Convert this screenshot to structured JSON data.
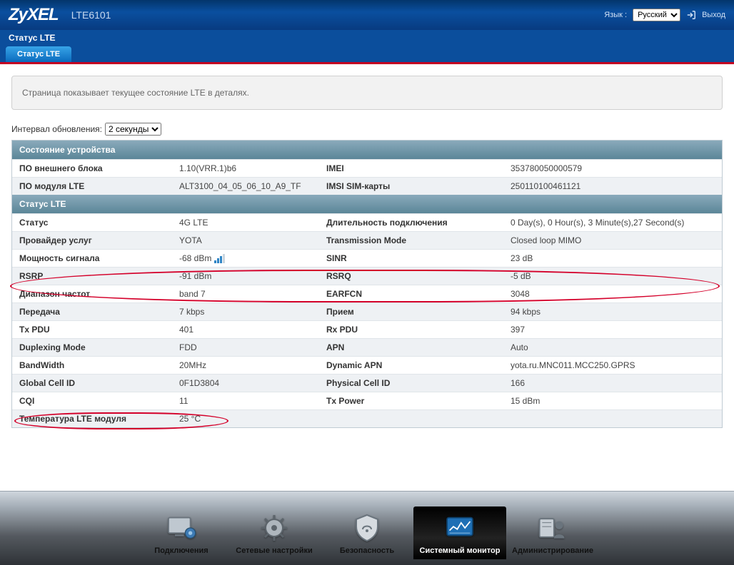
{
  "header": {
    "brand": "ZyXEL",
    "model": "LTE6101",
    "lang_label": "Язык :",
    "lang_value": "Русский",
    "logout": "Выход"
  },
  "crumb": "Статус LTE",
  "tab": "Статус LTE",
  "description": "Страница показывает текущее состояние LTE в деталях.",
  "refresh": {
    "label": "Интервал обновления:",
    "value": "2 секунды"
  },
  "sections": {
    "device_state": "Состояние устройства",
    "lte_status": "Статус LTE"
  },
  "rows_dev": [
    {
      "l1": "ПО внешнего блока",
      "v1": "1.10(VRR.1)b6",
      "l2": "IMEI",
      "v2": "353780050000579"
    },
    {
      "l1": "ПО модуля LTE",
      "v1": "ALT3100_04_05_06_10_A9_TF",
      "l2": "IMSI SIM-карты",
      "v2": "250110100461121"
    }
  ],
  "rows_lte": [
    {
      "l1": "Статус",
      "v1": "4G LTE",
      "l2": "Длительность подключения",
      "v2": "0 Day(s), 0 Hour(s), 3 Minute(s),27 Second(s)"
    },
    {
      "l1": "Провайдер услуг",
      "v1": "YOTA",
      "l2": "Transmission Mode",
      "v2": "Closed loop MIMO"
    },
    {
      "l1": "Мощность сигнала",
      "v1": "-68 dBm",
      "sig": true,
      "l2": "SINR",
      "v2": "23 dB"
    },
    {
      "l1": "RSRP",
      "v1": "-91 dBm",
      "l2": "RSRQ",
      "v2": "-5 dB"
    },
    {
      "l1": "Диапазон частот",
      "v1": "band 7",
      "l2": "EARFCN",
      "v2": "3048"
    },
    {
      "l1": "Передача",
      "v1": "7 kbps",
      "l2": "Прием",
      "v2": "94 kbps"
    },
    {
      "l1": "Tx PDU",
      "v1": "401",
      "l2": "Rx PDU",
      "v2": "397"
    },
    {
      "l1": "Duplexing Mode",
      "v1": "FDD",
      "l2": "APN",
      "v2": "Auto"
    },
    {
      "l1": "BandWidth",
      "v1": "20MHz",
      "l2": "Dynamic APN",
      "v2": "yota.ru.MNC011.MCC250.GPRS"
    },
    {
      "l1": "Global Cell ID",
      "v1": "0F1D3804",
      "l2": "Physical Cell ID",
      "v2": "166"
    },
    {
      "l1": "CQI",
      "v1": "11",
      "l2": "Tx Power",
      "v2": "15 dBm"
    },
    {
      "l1": "Температура LTE модуля",
      "v1": "25 °C",
      "l2": "",
      "v2": ""
    }
  ],
  "dock": {
    "items": [
      "Подключения",
      "Сетевые настройки",
      "Безопасность",
      "Системный монитор",
      "Администрирование"
    ]
  }
}
